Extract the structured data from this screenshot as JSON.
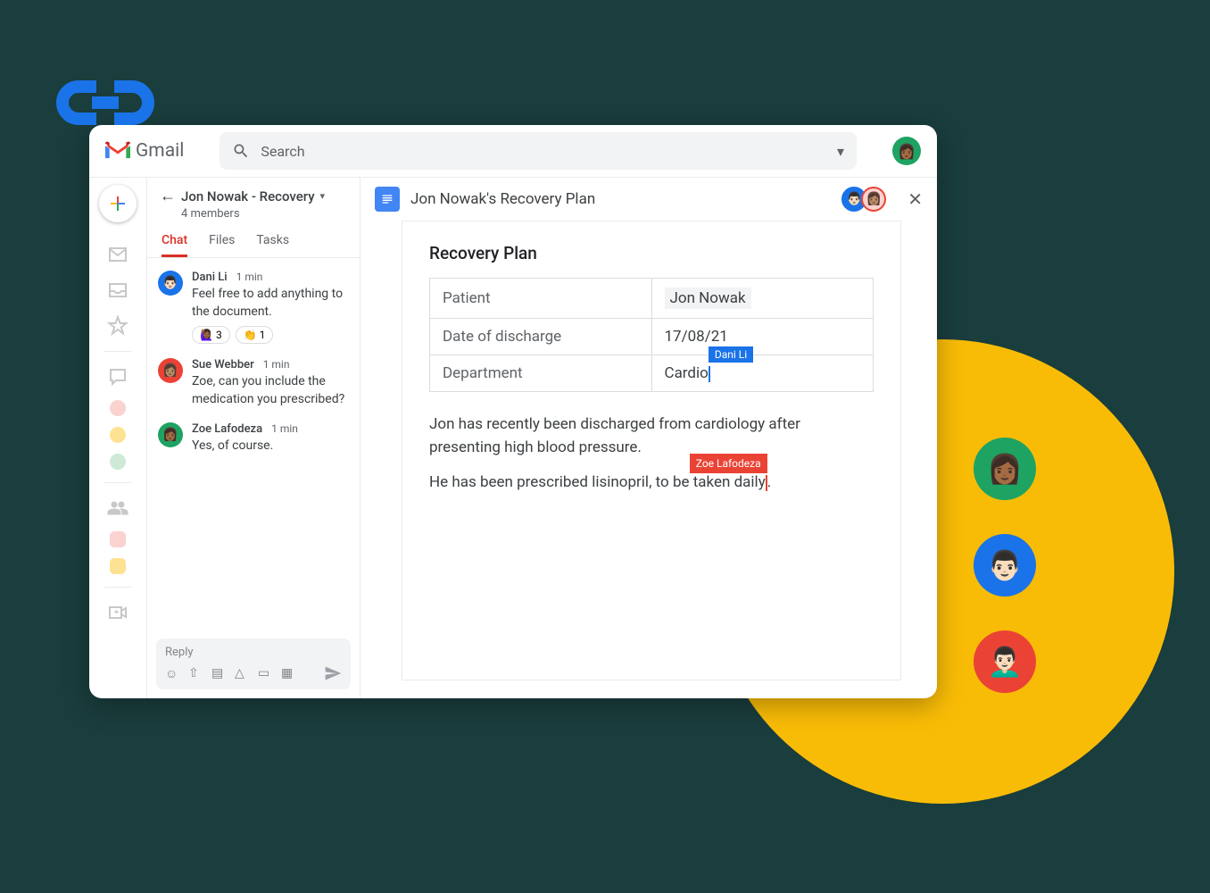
{
  "header": {
    "app_name": "Gmail",
    "search_placeholder": "Search"
  },
  "chat": {
    "title": "Jon Nowak - Recovery",
    "members_text": "4 members",
    "tabs": [
      "Chat",
      "Files",
      "Tasks"
    ],
    "active_tab": "Chat",
    "messages": [
      {
        "author": "Dani Li",
        "time": "1 min",
        "text": "Feel free to add anything to the document.",
        "reactions": [
          {
            "emoji": "🙋🏾‍♀️",
            "count": "3"
          },
          {
            "emoji": "👏",
            "count": "1"
          }
        ]
      },
      {
        "author": "Sue Webber",
        "time": "1 min",
        "text": "Zoe, can you include the medication you prescribed?"
      },
      {
        "author": "Zoe Lafodeza",
        "time": "1 min",
        "text": "Yes, of course."
      }
    ],
    "reply_placeholder": "Reply"
  },
  "doc": {
    "title": "Jon Nowak's Recovery Plan",
    "heading": "Recovery Plan",
    "table": [
      {
        "label": "Patient",
        "value": "Jon Nowak"
      },
      {
        "label": "Date of discharge",
        "value": "17/08/21"
      },
      {
        "label": "Department",
        "value": "Cardio"
      }
    ],
    "cursor1_name": "Dani Li",
    "cursor2_name": "Zoe Lafodeza",
    "para1": "Jon has recently been discharged from cardiology after presenting high blood pressure.",
    "para2_part1": "He has been prescribed lisinopril, to be taken daily"
  }
}
